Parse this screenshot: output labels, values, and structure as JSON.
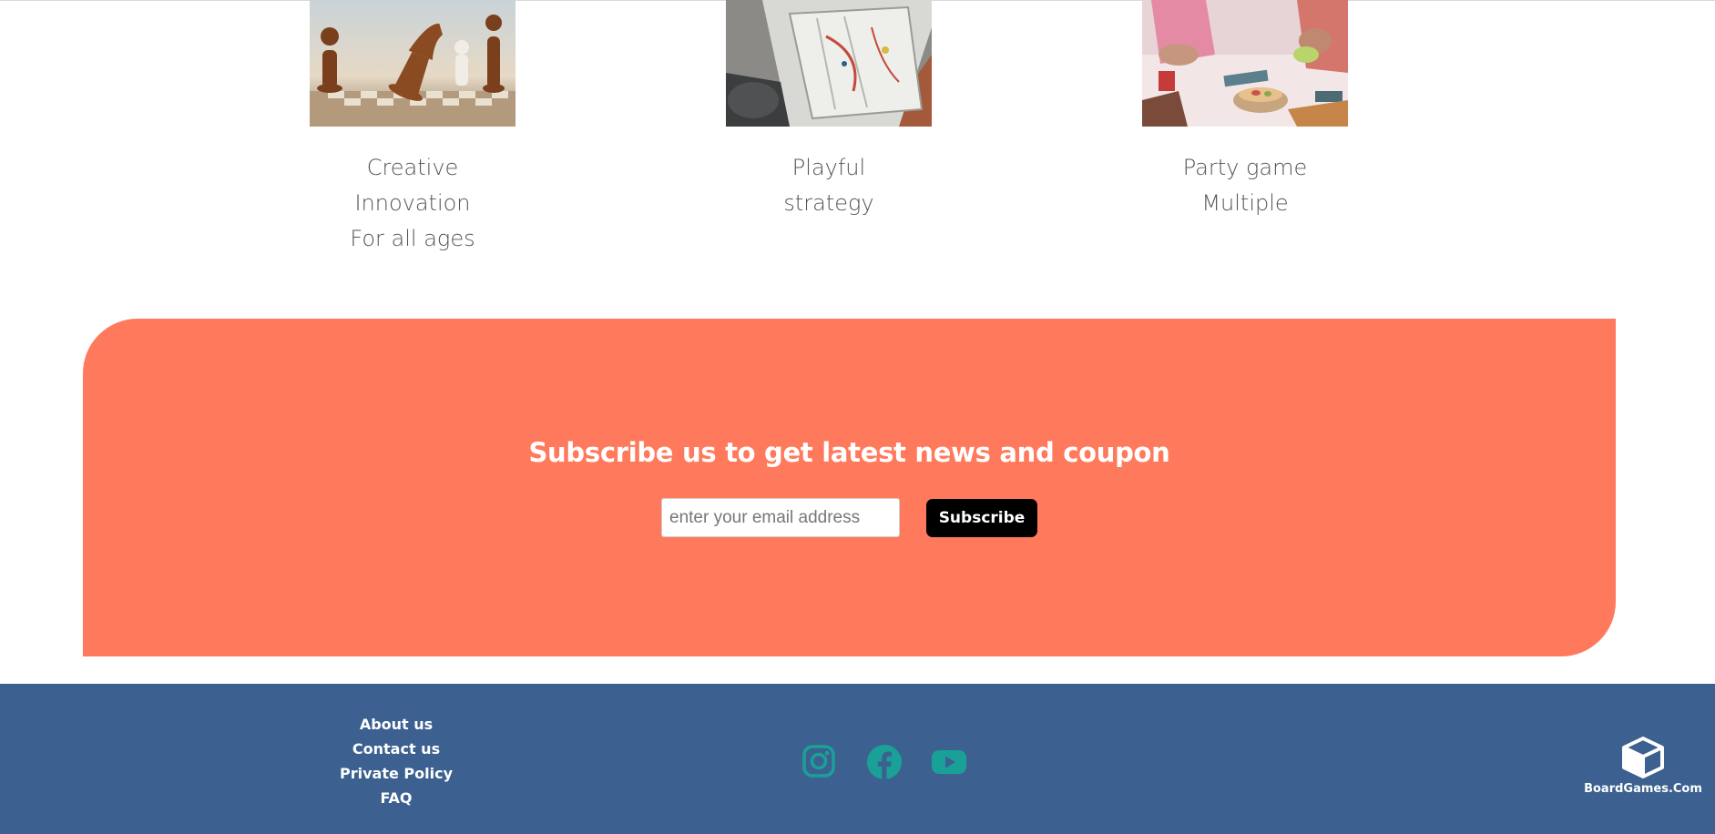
{
  "cards": [
    {
      "image": "chess-pieces-photo",
      "lines": [
        "Creative",
        "Innovation",
        "For all ages"
      ]
    },
    {
      "image": "board-game-map-photo",
      "lines": [
        "Playful",
        "strategy"
      ]
    },
    {
      "image": "party-game-table-photo",
      "lines": [
        "Party game",
        "Multiple"
      ]
    }
  ],
  "subscribe": {
    "title": "Subscribe us to get latest news and coupon",
    "email_placeholder": "enter your email address",
    "button_label": "Subscribe"
  },
  "footer": {
    "links": [
      "About us",
      "Contact us",
      "Private Policy",
      "FAQ"
    ],
    "social_icons": [
      "instagram-icon",
      "facebook-icon",
      "youtube-icon"
    ],
    "brand_name": "BoardGames.Com",
    "brand_icon": "cube-logo-icon"
  },
  "colors": {
    "subscribe_bg": "#ff7a5c",
    "footer_bg": "#3c608f",
    "social_icon": "#1aa197",
    "button_bg": "#000000"
  }
}
